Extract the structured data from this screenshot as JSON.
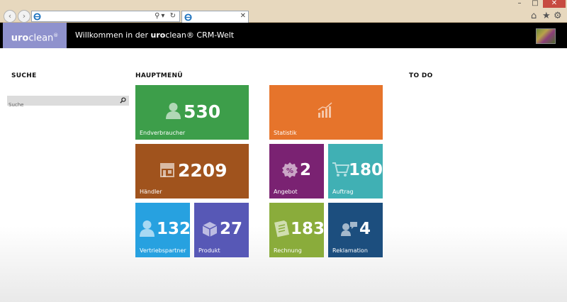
{
  "browser": {
    "nav_back_icon": "arrow-left-icon",
    "nav_forward_icon": "arrow-right-icon",
    "address_value": "",
    "tab_title": "",
    "window_buttons": {
      "minimize": "–",
      "maximize": "□",
      "close": "✕"
    },
    "toolbar_icons": [
      "home-icon",
      "star-icon",
      "gear-icon"
    ]
  },
  "header": {
    "logo_prefix": "uro",
    "logo_suffix": "clean",
    "logo_reg": "®",
    "welcome_prefix": "Willkommen in der ",
    "welcome_brand_bold": "uro",
    "welcome_brand_rest": "clean",
    "welcome_suffix": "® CRM-Welt"
  },
  "sections": {
    "search": "SUCHE",
    "main_menu": "HAUPTMENÜ",
    "todo": "TO DO"
  },
  "search": {
    "placeholder": "Suche",
    "value": ""
  },
  "tiles": {
    "endverbraucher": {
      "value": "530",
      "label": "Endverbraucher",
      "color": "#3d9e4a",
      "icon": "user-icon"
    },
    "statistik": {
      "value": "",
      "label": "Statistik",
      "color": "#e6742b",
      "icon": "bar-chart-icon"
    },
    "haendler": {
      "value": "2209",
      "label": "Händler",
      "color": "#a0531d",
      "icon": "store-icon"
    },
    "angebot": {
      "value": "2",
      "label": "Angebot",
      "color": "#7a2272",
      "icon": "percent-badge-icon"
    },
    "auftrag": {
      "value": "180",
      "label": "Auftrag",
      "color": "#40b0b4",
      "icon": "shopping-cart-icon"
    },
    "vertriebspartner": {
      "value": "132",
      "label": "Vertriebspartner",
      "color": "#27a1e0",
      "icon": "sales-partner-icon"
    },
    "produkt": {
      "value": "27",
      "label": "Produkt",
      "color": "#5758b6",
      "icon": "package-icon"
    },
    "rechnung": {
      "value": "183",
      "label": "Rechnung",
      "color": "#8aac3b",
      "icon": "invoice-icon"
    },
    "reklamation": {
      "value": "4",
      "label": "Reklamation",
      "color": "#1c4e7e",
      "icon": "complaint-icon"
    }
  }
}
